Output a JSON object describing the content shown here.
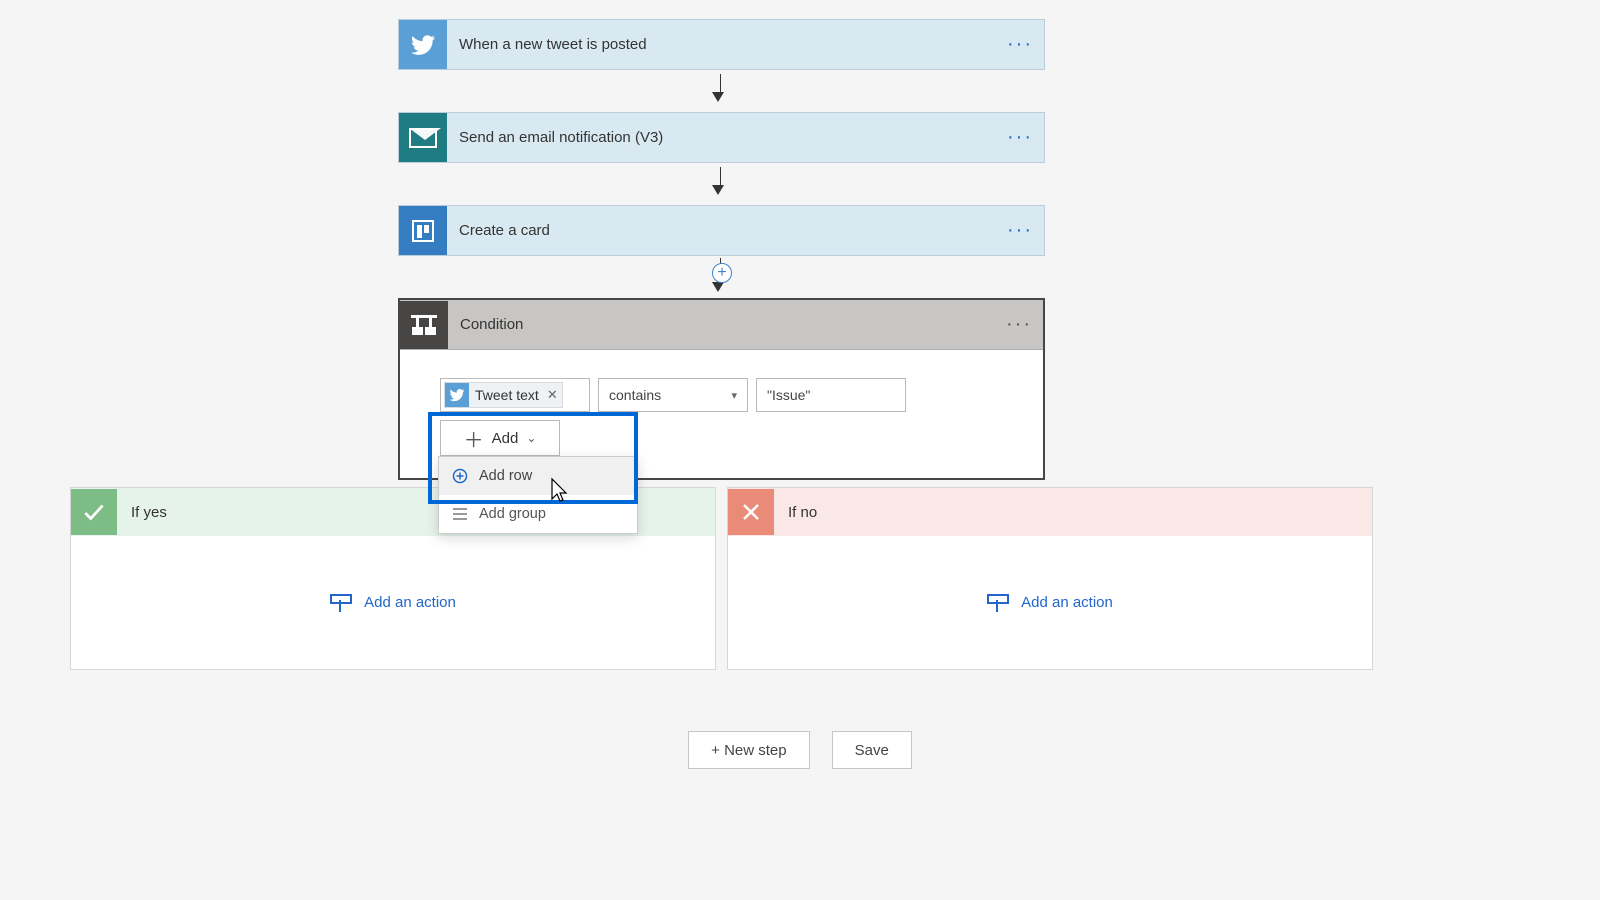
{
  "steps": [
    {
      "label": "When a new tweet is posted"
    },
    {
      "label": "Send an email notification (V3)"
    },
    {
      "label": "Create a card"
    }
  ],
  "condition": {
    "title": "Condition",
    "token": "Tweet text",
    "operator": "contains",
    "value": "\"Issue\"",
    "add_button": "Add",
    "menu": {
      "row": "Add row",
      "group": "Add group"
    }
  },
  "branches": {
    "yes_label": "If yes",
    "no_label": "If no",
    "add_action": "Add an action"
  },
  "footer": {
    "new_step": "+ New step",
    "save": "Save"
  }
}
